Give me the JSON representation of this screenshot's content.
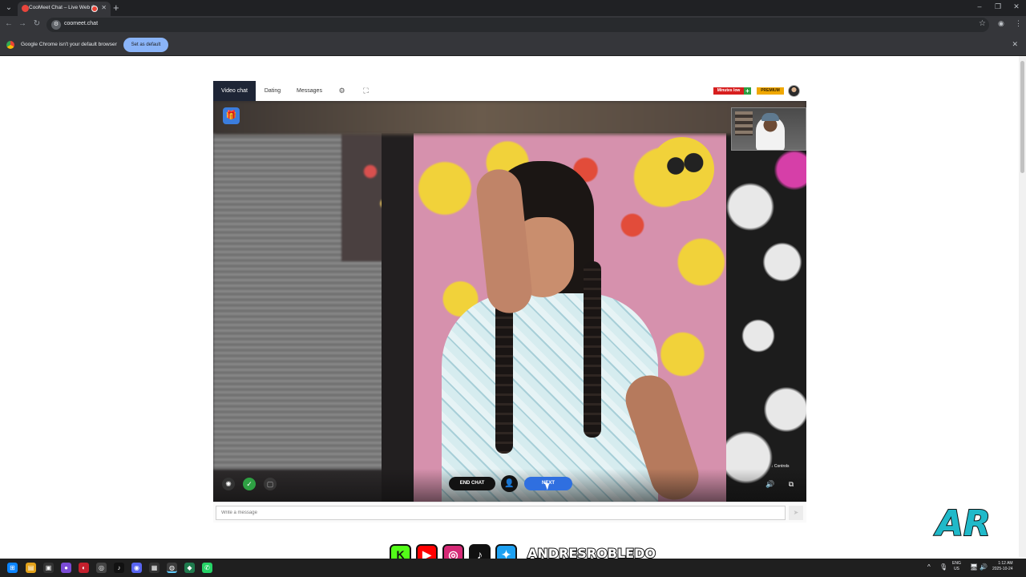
{
  "browser": {
    "tab_title": "CooMeet Chat – Live Web C",
    "new_tab_icon": "+",
    "url": "coomeet.chat",
    "infobar_message": "Google Chrome isn't your default browser",
    "infobar_button": "Set as default"
  },
  "app": {
    "nav_tabs": [
      {
        "label": "Video chat",
        "active": true
      },
      {
        "label": "Dating",
        "active": false
      },
      {
        "label": "Messages",
        "active": false
      }
    ],
    "badges": {
      "minutes": "Minutes low",
      "plus": "+",
      "premium": "PREMIUM"
    },
    "controls_label": "Controls",
    "end_chat_label": "END CHAT",
    "next_label": "NEXT",
    "message_placeholder": "Write a message"
  },
  "overlay": {
    "social_handle": "ANDRESROBLEDO",
    "logo_text": "AR"
  },
  "taskbar": {
    "lang_line1": "ENG",
    "lang_line2": "US",
    "time": "1:12 AM",
    "date": "2025-10-24"
  },
  "colors": {
    "accent_blue": "#2f6fe0",
    "nav_active": "#1e2536",
    "minutes_badge": "#d71e1e",
    "premium_badge": "#f0a800",
    "logo_cyan": "#20b9c9"
  }
}
